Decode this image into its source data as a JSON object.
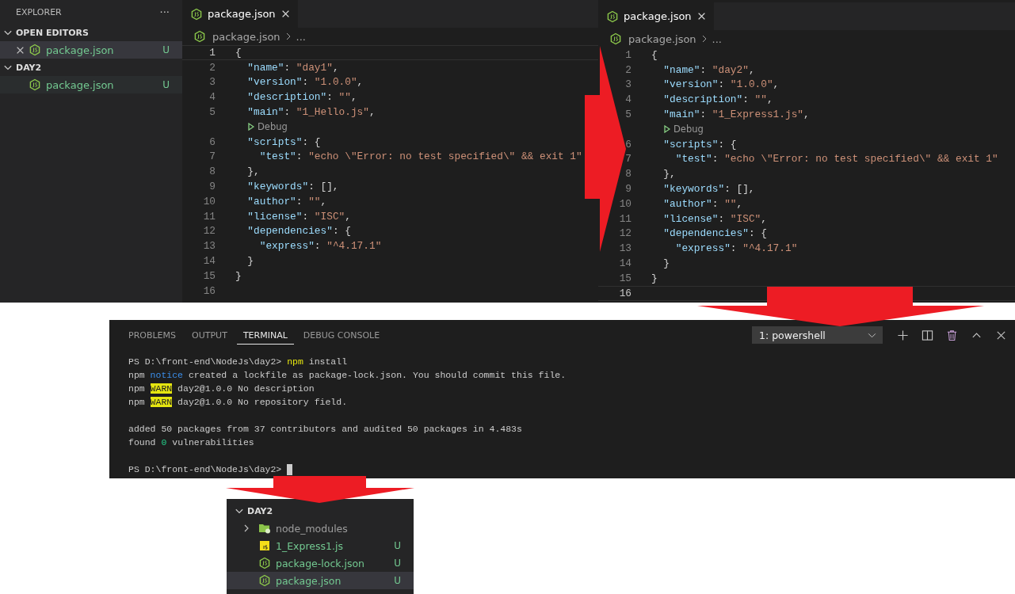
{
  "explorer": {
    "title": "EXPLORER",
    "more": "···",
    "sections": [
      {
        "label": "OPEN EDITORS",
        "expanded": true,
        "items": [
          {
            "label": "package.json",
            "kind": "json",
            "badge": "U",
            "closable": true,
            "selected": true
          }
        ]
      },
      {
        "label": "DAY2",
        "expanded": true,
        "items": [
          {
            "label": "package.json",
            "kind": "json",
            "badge": "U",
            "closable": false,
            "selected": true
          }
        ]
      }
    ]
  },
  "editors": [
    {
      "tab": {
        "label": "package.json",
        "selected": true
      },
      "breadcrumb": [
        "package.json",
        "..."
      ],
      "lines": [
        {
          "kind": "code",
          "number": "1",
          "current": true,
          "tokens": [
            {
              "kind": "punct",
              "t": "{"
            }
          ]
        },
        {
          "kind": "code",
          "number": "2",
          "current": false,
          "tokens": [
            {
              "kind": "key",
              "t": "  \"name\""
            },
            {
              "kind": "punct",
              "t": ": "
            },
            {
              "kind": "string",
              "t": "\"day1\""
            },
            {
              "kind": "punct",
              "t": ","
            }
          ]
        },
        {
          "kind": "code",
          "number": "3",
          "current": false,
          "tokens": [
            {
              "kind": "key",
              "t": "  \"version\""
            },
            {
              "kind": "punct",
              "t": ": "
            },
            {
              "kind": "string",
              "t": "\"1.0.0\""
            },
            {
              "kind": "punct",
              "t": ","
            }
          ]
        },
        {
          "kind": "code",
          "number": "4",
          "current": false,
          "tokens": [
            {
              "kind": "key",
              "t": "  \"description\""
            },
            {
              "kind": "punct",
              "t": ": "
            },
            {
              "kind": "string",
              "t": "\"\""
            },
            {
              "kind": "punct",
              "t": ","
            }
          ]
        },
        {
          "kind": "code",
          "number": "5",
          "current": false,
          "tokens": [
            {
              "kind": "key",
              "t": "  \"main\""
            },
            {
              "kind": "punct",
              "t": ": "
            },
            {
              "kind": "string",
              "t": "\"1_Hello.js\""
            },
            {
              "kind": "punct",
              "t": ","
            }
          ]
        },
        {
          "kind": "codelens",
          "text": "Debug"
        },
        {
          "kind": "code",
          "number": "6",
          "current": false,
          "tokens": [
            {
              "kind": "key",
              "t": "  \"scripts\""
            },
            {
              "kind": "punct",
              "t": ": {"
            }
          ]
        },
        {
          "kind": "code",
          "number": "7",
          "current": false,
          "tokens": [
            {
              "kind": "key",
              "t": "    \"test\""
            },
            {
              "kind": "punct",
              "t": ": "
            },
            {
              "kind": "string",
              "t": "\"echo \\\"Error: no test specified\\\" && exit 1\""
            }
          ]
        },
        {
          "kind": "code",
          "number": "8",
          "current": false,
          "tokens": [
            {
              "kind": "punct",
              "t": "  },"
            }
          ]
        },
        {
          "kind": "code",
          "number": "9",
          "current": false,
          "tokens": [
            {
              "kind": "key",
              "t": "  \"keywords\""
            },
            {
              "kind": "punct",
              "t": ": [],"
            }
          ]
        },
        {
          "kind": "code",
          "number": "10",
          "current": false,
          "tokens": [
            {
              "kind": "key",
              "t": "  \"author\""
            },
            {
              "kind": "punct",
              "t": ": "
            },
            {
              "kind": "string",
              "t": "\"\""
            },
            {
              "kind": "punct",
              "t": ","
            }
          ]
        },
        {
          "kind": "code",
          "number": "11",
          "current": false,
          "tokens": [
            {
              "kind": "key",
              "t": "  \"license\""
            },
            {
              "kind": "punct",
              "t": ": "
            },
            {
              "kind": "string",
              "t": "\"ISC\""
            },
            {
              "kind": "punct",
              "t": ","
            }
          ]
        },
        {
          "kind": "code",
          "number": "12",
          "current": false,
          "tokens": [
            {
              "kind": "key",
              "t": "  \"dependencies\""
            },
            {
              "kind": "punct",
              "t": ": {"
            }
          ]
        },
        {
          "kind": "code",
          "number": "13",
          "current": false,
          "tokens": [
            {
              "kind": "key",
              "t": "    \"express\""
            },
            {
              "kind": "punct",
              "t": ": "
            },
            {
              "kind": "string",
              "t": "\"^4.17.1\""
            }
          ]
        },
        {
          "kind": "code",
          "number": "14",
          "current": false,
          "tokens": [
            {
              "kind": "punct",
              "t": "  }"
            }
          ]
        },
        {
          "kind": "code",
          "number": "15",
          "current": false,
          "tokens": [
            {
              "kind": "punct",
              "t": "}"
            }
          ]
        },
        {
          "kind": "code",
          "number": "16",
          "current": false
        }
      ]
    },
    {
      "tab": {
        "label": "package.json",
        "selected": true
      },
      "breadcrumb": [
        "package.json",
        "..."
      ],
      "lines": [
        {
          "kind": "code",
          "number": "1",
          "current": false,
          "tokens": [
            {
              "kind": "punct",
              "t": "{"
            }
          ]
        },
        {
          "kind": "code",
          "number": "2",
          "current": false,
          "tokens": [
            {
              "kind": "key",
              "t": "  \"name\""
            },
            {
              "kind": "punct",
              "t": ": "
            },
            {
              "kind": "string",
              "t": "\"day2\""
            },
            {
              "kind": "punct",
              "t": ","
            }
          ]
        },
        {
          "kind": "code",
          "number": "3",
          "current": false,
          "tokens": [
            {
              "kind": "key",
              "t": "  \"version\""
            },
            {
              "kind": "punct",
              "t": ": "
            },
            {
              "kind": "string",
              "t": "\"1.0.0\""
            },
            {
              "kind": "punct",
              "t": ","
            }
          ]
        },
        {
          "kind": "code",
          "number": "4",
          "current": false,
          "tokens": [
            {
              "kind": "key",
              "t": "  \"description\""
            },
            {
              "kind": "punct",
              "t": ": "
            },
            {
              "kind": "string",
              "t": "\"\""
            },
            {
              "kind": "punct",
              "t": ","
            }
          ]
        },
        {
          "kind": "code",
          "number": "5",
          "current": false,
          "tokens": [
            {
              "kind": "key",
              "t": "  \"main\""
            },
            {
              "kind": "punct",
              "t": ": "
            },
            {
              "kind": "string",
              "t": "\"1_Express1.js\""
            },
            {
              "kind": "punct",
              "t": ","
            }
          ]
        },
        {
          "kind": "codelens",
          "text": "Debug"
        },
        {
          "kind": "code",
          "number": "6",
          "current": false,
          "tokens": [
            {
              "kind": "key",
              "t": "  \"scripts\""
            },
            {
              "kind": "punct",
              "t": ": {"
            }
          ]
        },
        {
          "kind": "code",
          "number": "7",
          "current": false,
          "tokens": [
            {
              "kind": "key",
              "t": "    \"test\""
            },
            {
              "kind": "punct",
              "t": ": "
            },
            {
              "kind": "string",
              "t": "\"echo \\\"Error: no test specified\\\" && exit 1\""
            }
          ]
        },
        {
          "kind": "code",
          "number": "8",
          "current": false,
          "tokens": [
            {
              "kind": "punct",
              "t": "  },"
            }
          ]
        },
        {
          "kind": "code",
          "number": "9",
          "current": false,
          "tokens": [
            {
              "kind": "key",
              "t": "  \"keywords\""
            },
            {
              "kind": "punct",
              "t": ": [],"
            }
          ]
        },
        {
          "kind": "code",
          "number": "10",
          "current": false,
          "tokens": [
            {
              "kind": "key",
              "t": "  \"author\""
            },
            {
              "kind": "punct",
              "t": ": "
            },
            {
              "kind": "string",
              "t": "\"\""
            },
            {
              "kind": "punct",
              "t": ","
            }
          ]
        },
        {
          "kind": "code",
          "number": "11",
          "current": false,
          "tokens": [
            {
              "kind": "key",
              "t": "  \"license\""
            },
            {
              "kind": "punct",
              "t": ": "
            },
            {
              "kind": "string",
              "t": "\"ISC\""
            },
            {
              "kind": "punct",
              "t": ","
            }
          ]
        },
        {
          "kind": "code",
          "number": "12",
          "current": false,
          "tokens": [
            {
              "kind": "key",
              "t": "  \"dependencies\""
            },
            {
              "kind": "punct",
              "t": ": {"
            }
          ]
        },
        {
          "kind": "code",
          "number": "13",
          "current": false,
          "tokens": [
            {
              "kind": "key",
              "t": "    \"express\""
            },
            {
              "kind": "punct",
              "t": ": "
            },
            {
              "kind": "string",
              "t": "\"^4.17.1\""
            }
          ]
        },
        {
          "kind": "code",
          "number": "14",
          "current": false,
          "tokens": [
            {
              "kind": "punct",
              "t": "  }"
            }
          ]
        },
        {
          "kind": "code",
          "number": "15",
          "current": false,
          "tokens": [
            {
              "kind": "punct",
              "t": "}"
            }
          ]
        },
        {
          "kind": "code",
          "number": "16",
          "current": true
        }
      ]
    }
  ],
  "terminal": {
    "tabs": [
      {
        "label": "PROBLEMS",
        "selected": false
      },
      {
        "label": "OUTPUT",
        "selected": false
      },
      {
        "label": "TERMINAL",
        "selected": true
      },
      {
        "label": "DEBUG CONSOLE",
        "selected": false
      }
    ],
    "shell": "1: powershell",
    "lines": [
      {
        "kind": "text",
        "tokens": [
          {
            "kind": "plain",
            "t": "PS D:\\front-end\\NodeJs\\day2> "
          },
          {
            "kind": "cmd",
            "t": "npm"
          },
          {
            "kind": "plain",
            "t": " install"
          }
        ]
      },
      {
        "kind": "text",
        "tokens": [
          {
            "kind": "plain",
            "t": "npm "
          },
          {
            "kind": "notice",
            "t": "notice"
          },
          {
            "kind": "plain",
            "t": " created a lockfile as package-lock.json. You should commit this file."
          }
        ]
      },
      {
        "kind": "text",
        "tokens": [
          {
            "kind": "plain",
            "t": "npm "
          },
          {
            "kind": "warn",
            "t": "WARN"
          },
          {
            "kind": "plain",
            "t": " day2@1.0.0 No description"
          }
        ]
      },
      {
        "kind": "text",
        "tokens": [
          {
            "kind": "plain",
            "t": "npm "
          },
          {
            "kind": "warn",
            "t": "WARN"
          },
          {
            "kind": "plain",
            "t": " day2@1.0.0 No repository field."
          }
        ]
      },
      {
        "kind": "blank"
      },
      {
        "kind": "text",
        "tokens": [
          {
            "kind": "plain",
            "t": "added 50 packages from 37 contributors and audited 50 packages in 4.483s"
          }
        ]
      },
      {
        "kind": "text",
        "tokens": [
          {
            "kind": "plain",
            "t": "found "
          },
          {
            "kind": "num",
            "t": "0"
          },
          {
            "kind": "plain",
            "t": " vulnerabilities"
          }
        ]
      },
      {
        "kind": "blank"
      },
      {
        "kind": "prompt",
        "tokens": [
          {
            "kind": "plain",
            "t": "PS D:\\front-end\\NodeJs\\day2> "
          }
        ]
      }
    ]
  },
  "file_tree": {
    "section": "DAY2",
    "expanded": true,
    "items": [
      {
        "label": "node_modules",
        "kind": "folder",
        "expanded": false,
        "selected": false
      },
      {
        "label": "1_Express1.js",
        "kind": "js",
        "badge": "U",
        "selected": false
      },
      {
        "label": "package-lock.json",
        "kind": "json",
        "badge": "U",
        "selected": false
      },
      {
        "label": "package.json",
        "kind": "json",
        "badge": "U",
        "selected": true
      }
    ]
  }
}
